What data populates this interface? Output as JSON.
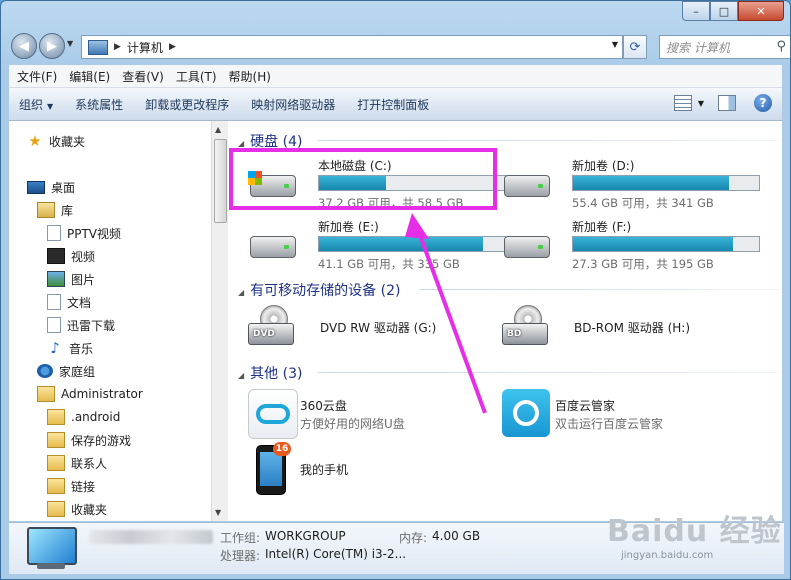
{
  "window": {
    "buttons": [
      "–",
      "□",
      "✕"
    ]
  },
  "address": {
    "breadcrumb": [
      "计算机"
    ]
  },
  "search": {
    "placeholder": "搜索 计算机"
  },
  "menu": [
    "文件(F)",
    "编辑(E)",
    "查看(V)",
    "工具(T)",
    "帮助(H)"
  ],
  "commands": [
    {
      "label": "组织",
      "dropdown": true
    },
    {
      "label": "系统属性"
    },
    {
      "label": "卸载或更改程序"
    },
    {
      "label": "映射网络驱动器"
    },
    {
      "label": "打开控制面板"
    }
  ],
  "nav": [
    {
      "label": "收藏夹",
      "icon": "star-icon",
      "indent": 0
    },
    {
      "label": "桌面",
      "icon": "desktop-icon",
      "indent": 0
    },
    {
      "label": "库",
      "icon": "library-icon",
      "indent": 1
    },
    {
      "label": "PPTV视频",
      "icon": "document-icon",
      "indent": 2
    },
    {
      "label": "视频",
      "icon": "video-icon",
      "indent": 2
    },
    {
      "label": "图片",
      "icon": "picture-icon",
      "indent": 2
    },
    {
      "label": "文档",
      "icon": "document-icon",
      "indent": 2
    },
    {
      "label": "迅雷下载",
      "icon": "document-icon",
      "indent": 2
    },
    {
      "label": "音乐",
      "icon": "music-icon",
      "indent": 2
    },
    {
      "label": "家庭组",
      "icon": "homegroup-icon",
      "indent": 1
    },
    {
      "label": "Administrator",
      "icon": "user-folder-icon",
      "indent": 1
    },
    {
      "label": ".android",
      "icon": "folder-icon",
      "indent": 2
    },
    {
      "label": "保存的游戏",
      "icon": "folder-icon",
      "indent": 2
    },
    {
      "label": "联系人",
      "icon": "folder-icon",
      "indent": 2
    },
    {
      "label": "链接",
      "icon": "folder-icon",
      "indent": 2
    },
    {
      "label": "收藏夹",
      "icon": "folder-icon",
      "indent": 2
    }
  ],
  "groups": {
    "hard_disks": "硬盘 (4)",
    "removable": "有可移动存储的设备 (2)",
    "other": "其他 (3)"
  },
  "drives": [
    {
      "name": "本地磁盘 (C:)",
      "info": "37.2 GB 可用，共 58.5 GB",
      "used_fraction": 0.36,
      "system": true
    },
    {
      "name": "新加卷 (D:)",
      "info": "55.4 GB 可用，共 341 GB",
      "used_fraction": 0.84,
      "system": false
    },
    {
      "name": "新加卷 (E:)",
      "info": "41.1 GB 可用，共 335 GB",
      "used_fraction": 0.88,
      "system": false
    },
    {
      "name": "新加卷 (F:)",
      "info": "27.3 GB 可用，共 195 GB",
      "used_fraction": 0.86,
      "system": false
    }
  ],
  "removables": [
    {
      "name": "DVD RW 驱动器 (G:)",
      "badge": "DVD"
    },
    {
      "name": "BD-ROM 驱动器 (H:)",
      "badge": "BD"
    }
  ],
  "others": [
    {
      "name": "360云盘",
      "desc": "方便好用的网络U盘"
    },
    {
      "name": "百度云管家",
      "desc": "双击运行百度云管家"
    },
    {
      "name": "我的手机",
      "desc": "",
      "badge": "16"
    }
  ],
  "details": {
    "workgroup_label": "工作组:",
    "workgroup": "WORKGROUP",
    "memory_label": "内存:",
    "memory": "4.00 GB",
    "cpu_label": "处理器:",
    "cpu": "Intel(R) Core(TM) i3-2..."
  },
  "watermark": {
    "big": "Baidu 经验",
    "small": "jingyan.baidu.com"
  },
  "colors": {
    "annotation": "#e62ee6",
    "disk_bar": "#1787ad",
    "group_header": "#1e3287"
  }
}
